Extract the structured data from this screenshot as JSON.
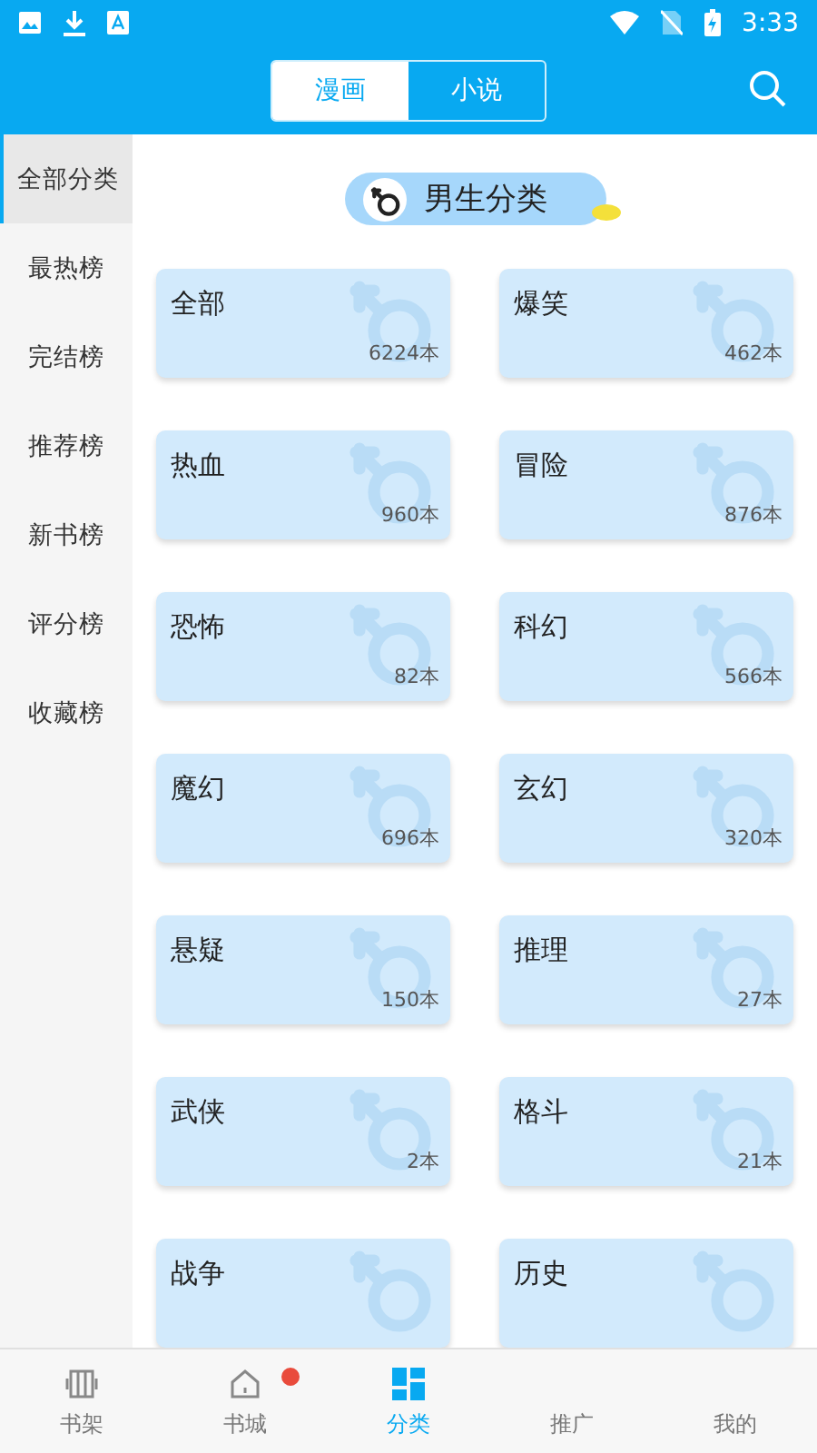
{
  "status_bar": {
    "time": "3:33"
  },
  "header": {
    "tabs": [
      {
        "label": "漫画",
        "selected": true
      },
      {
        "label": "小说",
        "selected": false
      }
    ]
  },
  "sidebar": {
    "items": [
      {
        "label": "全部分类",
        "selected": true
      },
      {
        "label": "最热榜",
        "selected": false
      },
      {
        "label": "完结榜",
        "selected": false
      },
      {
        "label": "推荐榜",
        "selected": false
      },
      {
        "label": "新书榜",
        "selected": false
      },
      {
        "label": "评分榜",
        "selected": false
      },
      {
        "label": "收藏榜",
        "selected": false
      }
    ]
  },
  "section_title": "男生分类",
  "categories": [
    {
      "name": "全部",
      "count": "6224本"
    },
    {
      "name": "爆笑",
      "count": "462本"
    },
    {
      "name": "热血",
      "count": "960本"
    },
    {
      "name": "冒险",
      "count": "876本"
    },
    {
      "name": "恐怖",
      "count": "82本"
    },
    {
      "name": "科幻",
      "count": "566本"
    },
    {
      "name": "魔幻",
      "count": "696本"
    },
    {
      "name": "玄幻",
      "count": "320本"
    },
    {
      "name": "悬疑",
      "count": "150本"
    },
    {
      "name": "推理",
      "count": "27本"
    },
    {
      "name": "武侠",
      "count": "2本"
    },
    {
      "name": "格斗",
      "count": "21本"
    },
    {
      "name": "战争"
    },
    {
      "name": "历史"
    }
  ],
  "bottom_nav": [
    {
      "label": "书架",
      "selected": false,
      "kind": "shelf",
      "badge": false
    },
    {
      "label": "书城",
      "selected": false,
      "kind": "home",
      "badge": true
    },
    {
      "label": "分类",
      "selected": true,
      "kind": "grid",
      "badge": false
    },
    {
      "label": "推广",
      "selected": false,
      "kind": "plain",
      "badge": false
    },
    {
      "label": "我的",
      "selected": false,
      "kind": "plain",
      "badge": false
    }
  ]
}
